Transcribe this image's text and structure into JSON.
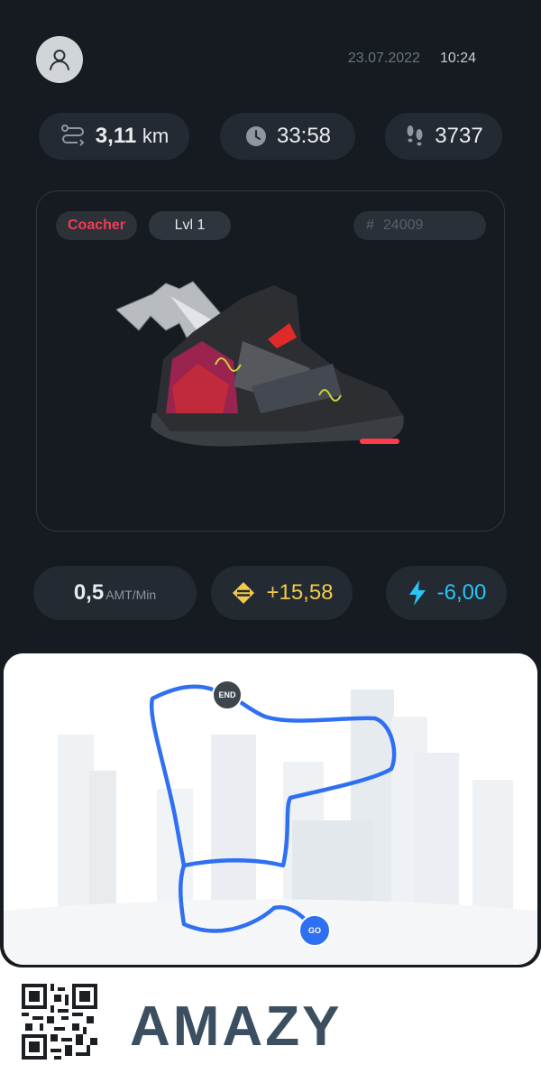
{
  "header": {
    "avatar_icon": "user-icon",
    "date": "23.07.2022",
    "time": "10:24"
  },
  "stats": {
    "distance_value": "3,11",
    "distance_unit": "km",
    "distance_icon": "route-icon",
    "duration": "33:58",
    "duration_icon": "clock-icon",
    "steps": "3737",
    "steps_icon": "footprints-icon"
  },
  "sneaker": {
    "type": "Coacher",
    "level": "Lvl 1",
    "id_hash": "#",
    "id": "24009"
  },
  "earnings": {
    "rate_value": "0,5",
    "rate_unit": "AMT/Min",
    "earned": "+15,58",
    "earned_icon": "token-icon",
    "energy": "-6,00",
    "energy_icon": "lightning-icon"
  },
  "route": {
    "end_label": "END",
    "start_label": "GO"
  },
  "brand": {
    "name": "AMAZY"
  },
  "colors": {
    "background": "#151b21",
    "pill": "#232a31",
    "role": "#ef3d57",
    "token": "#f2c94c",
    "energy": "#29c5f6",
    "route": "#2f6ff2"
  }
}
